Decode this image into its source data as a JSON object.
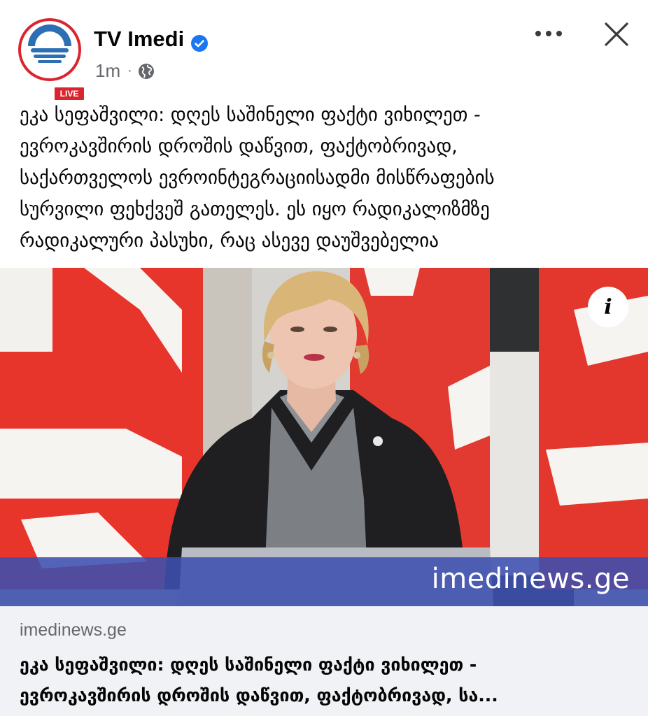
{
  "post": {
    "page_name": "TV Imedi",
    "avatar_badge": "LIVE",
    "verified": true,
    "timestamp": "1m",
    "separator": "·",
    "privacy_icon": "globe-icon",
    "more_icon": "more-horizontal-icon",
    "close_icon": "close-icon",
    "text": "ეკა სეფაშვილი: დღეს საშინელი ფაქტი ვიხილეთ -\nევროკავშირის დროშის დაწვით, ფაქტობრივად,\nსაქართველოს ევროინტეგრაციისადმი მისწრაფების\nსურვილი ფეხქვეშ გათელეს. ეს იყო რადიკალიზმზე\nრადიკალური პასუხი, რაც ასევე დაუშვებელია"
  },
  "image": {
    "watermark": "imedinews.ge",
    "info_icon_glyph": "i"
  },
  "link_preview": {
    "domain": "imedinews.ge",
    "title": "ეკა სეფაშვილი: დღეს საშინელი ფაქტი ვიხილეთ -\nევროკავშირის დროშის დაწვით, ფაქტობრივად, სა..."
  },
  "colors": {
    "brand_red": "#d9262e",
    "verified_blue": "#1877f2",
    "muted_text": "#65676b",
    "link_bg": "#f0f2f5",
    "watermark_band": "#3c50af"
  }
}
